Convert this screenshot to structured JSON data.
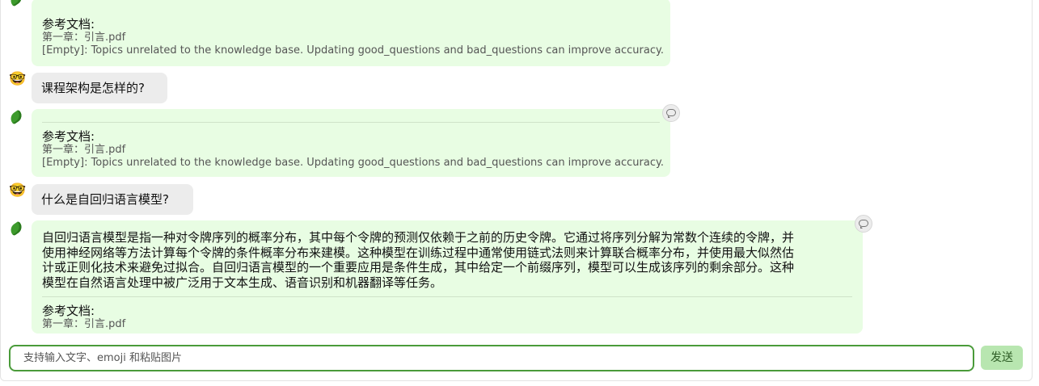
{
  "messages": [
    {
      "role": "bot",
      "reference": {
        "title": "参考文档:",
        "lines": [
          "第一章：引言.pdf",
          "[Empty]: Topics unrelated to the knowledge base. Updating good_questions and bad_questions can improve accuracy."
        ]
      }
    },
    {
      "role": "user",
      "avatar_icon": "nerd-face-emoji",
      "avatar_glyph": "🤓",
      "text": "课程架构是怎样的?"
    },
    {
      "role": "bot",
      "avatar_icon": "bean-avatar-icon",
      "reference": {
        "title": "参考文档:",
        "lines": [
          "第一章：引言.pdf",
          "[Empty]: Topics unrelated to the knowledge base. Updating good_questions and bad_questions can improve accuracy."
        ]
      }
    },
    {
      "role": "user",
      "avatar_icon": "nerd-face-emoji",
      "avatar_glyph": "🤓",
      "text": "什么是自回归语言模型?"
    },
    {
      "role": "bot",
      "avatar_icon": "bean-avatar-icon",
      "answer_lines": [
        "自回归语言模型是指一种对令牌序列的概率分布，其中每个令牌的预测仅依赖于之前的历史令牌。它通过将序列分解为常数个连续的令牌，并",
        "使用神经网络等方法计算每个令牌的条件概率分布来建模。这种模型在训练过程中通常使用链式法则来计算联合概率分布，并使用最大似然估",
        "计或正则化技术来避免过拟合。自回归语言模型的一个重要应用是条件生成，其中给定一个前缀序列，模型可以生成该序列的剩余部分。这种",
        "模型在自然语言处理中被广泛用于文本生成、语音识别和机器翻译等任务。"
      ],
      "reference": {
        "title": "参考文档:",
        "lines": [
          "第一章：引言.pdf"
        ]
      }
    }
  ],
  "input": {
    "placeholder": "支持输入文字、emoji 和粘贴图片",
    "value": ""
  },
  "send_label": "发送",
  "colors": {
    "bot_bubble": "#e8fde3",
    "user_bubble": "#ececec",
    "accent": "#4a9b3a",
    "send_button": "#b8e6b0"
  }
}
